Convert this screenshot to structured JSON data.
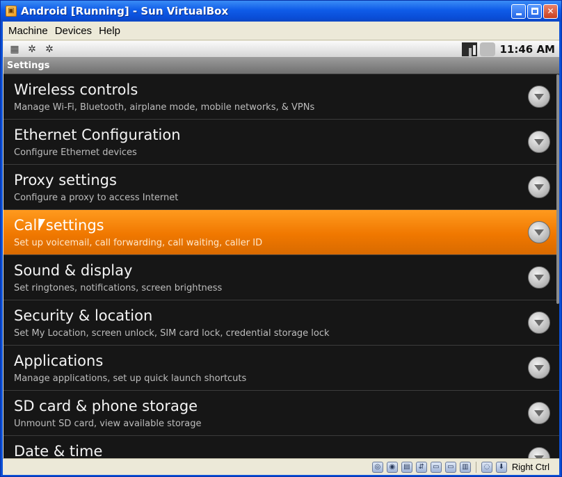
{
  "window": {
    "title": "Android [Running] - Sun VirtualBox"
  },
  "menubar": {
    "items": [
      "Machine",
      "Devices",
      "Help"
    ]
  },
  "statusbar": {
    "time": "11:46 AM"
  },
  "appbar": {
    "title": "Settings"
  },
  "settings": {
    "items": [
      {
        "title": "Wireless controls",
        "subtitle": "Manage Wi-Fi, Bluetooth, airplane mode, mobile networks, & VPNs"
      },
      {
        "title": "Ethernet Configuration",
        "subtitle": "Configure Ethernet devices"
      },
      {
        "title": "Proxy settings",
        "subtitle": "Configure a proxy to access Internet"
      },
      {
        "title": "Call settings",
        "subtitle": "Set up voicemail, call forwarding, call waiting, caller ID"
      },
      {
        "title": "Sound & display",
        "subtitle": "Set ringtones, notifications, screen brightness"
      },
      {
        "title": "Security & location",
        "subtitle": "Set My Location, screen unlock, SIM card lock, credential storage lock"
      },
      {
        "title": "Applications",
        "subtitle": "Manage applications, set up quick launch shortcuts"
      },
      {
        "title": "SD card & phone storage",
        "subtitle": "Unmount SD card, view available storage"
      },
      {
        "title": "Date & time",
        "subtitle": ""
      }
    ]
  },
  "vbstatus": {
    "host_key": "Right Ctrl"
  },
  "colors": {
    "titlebar": "#0a4ed8",
    "selected_row": "#f07800",
    "list_background": "#161616"
  }
}
